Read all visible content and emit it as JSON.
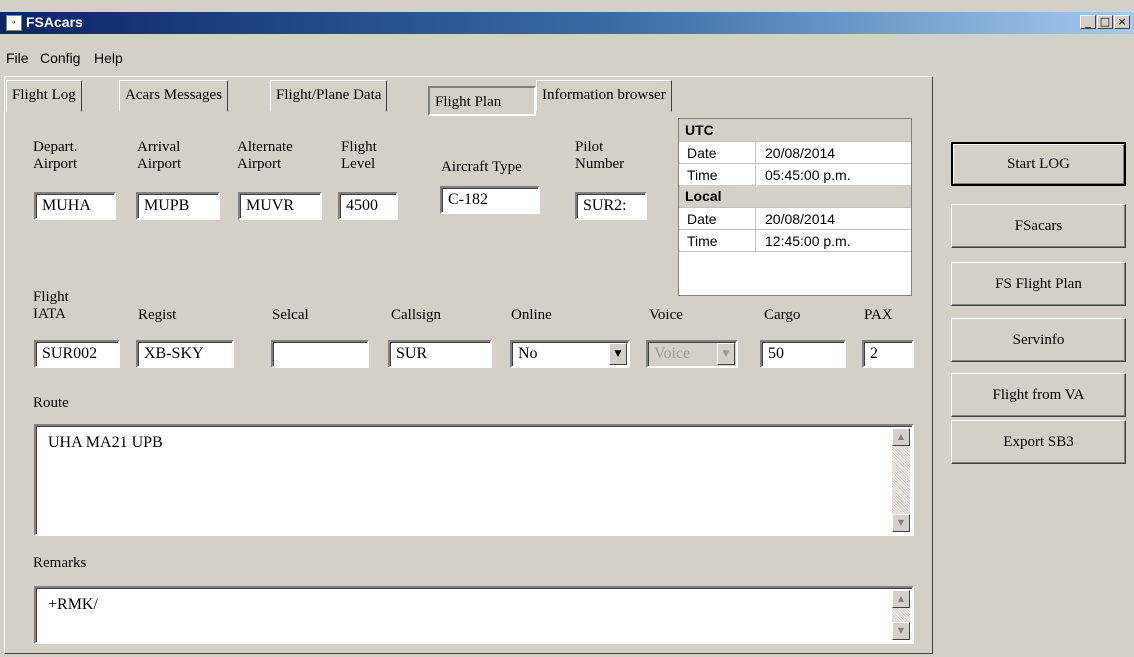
{
  "window": {
    "title": "FSAcars",
    "app_icon": "fsacars-app-icon",
    "controls": [
      "minimize",
      "maximize",
      "close"
    ]
  },
  "menu": {
    "items": [
      "File",
      "Config",
      "Help"
    ]
  },
  "tabs": [
    "Flight Log",
    "Acars Messages",
    "Flight/Plane Data",
    "Flight Plan",
    "Information browser"
  ],
  "active_tab": "Flight Plan",
  "fields": {
    "depart": {
      "label1": "Depart.",
      "label2": "Airport",
      "value": "MUHA"
    },
    "arrival": {
      "label1": "Arrival",
      "label2": "Airport",
      "value": "MUPB"
    },
    "alternate": {
      "label1": "Alternate",
      "label2": "Airport",
      "value": "MUVR"
    },
    "flight_level": {
      "label1": "Flight",
      "label2": "Level",
      "value": "4500"
    },
    "aircraft_type": {
      "label": "Aircraft Type",
      "value": "C-182"
    },
    "pilot_number": {
      "label1": "Pilot",
      "label2": "Number",
      "value": "SUR2:"
    },
    "flight_iata": {
      "label1": "Flight",
      "label2": "IATA",
      "value": "SUR002"
    },
    "regist": {
      "label": "Regist",
      "value": "XB-SKY"
    },
    "selcal": {
      "label": "Selcal",
      "value": ""
    },
    "callsign": {
      "label": "Callsign",
      "value": "SUR"
    },
    "online": {
      "label": "Online",
      "value": "No"
    },
    "voice": {
      "label": "Voice",
      "value": "Voice"
    },
    "cargo": {
      "label": "Cargo",
      "value": "50"
    },
    "pax": {
      "label": "PAX",
      "value": "2"
    },
    "route": {
      "label": "Route",
      "value": "UHA MA21 UPB"
    },
    "remarks": {
      "label": "Remarks",
      "value": "+RMK/"
    }
  },
  "time_info": {
    "utc": {
      "header": "UTC",
      "date_label": "Date",
      "date": "20/08/2014",
      "time_label": "Time",
      "time": "05:45:00 p.m."
    },
    "local": {
      "header": "Local",
      "date_label": "Date",
      "date": "20/08/2014",
      "time_label": "Time",
      "time": "12:45:00 p.m."
    }
  },
  "side_buttons": [
    "Start LOG",
    "FSacars",
    "FS Flight Plan",
    "Servinfo",
    "Flight from VA",
    "Export SB3"
  ],
  "colors": {
    "title_bar_start": "#0a246a",
    "title_bar_end": "#a6caf0",
    "window_face": "#d4d0c8"
  }
}
